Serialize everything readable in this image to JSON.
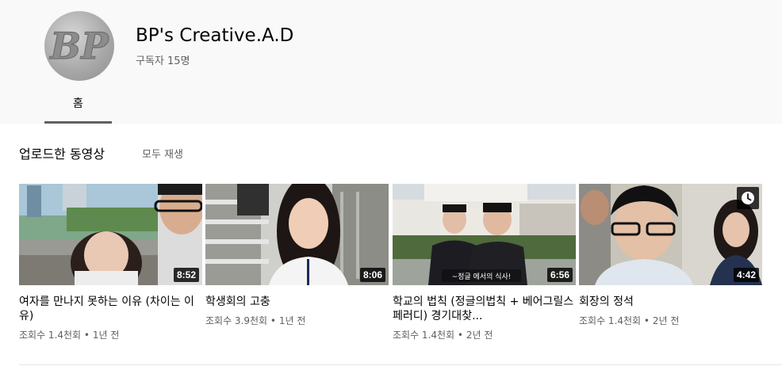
{
  "channel": {
    "name": "BP's Creative.A.D",
    "subscribers": "구독자 15명",
    "avatar_text": "BP"
  },
  "tabs": [
    {
      "label": "홈",
      "selected": true
    }
  ],
  "shelf": {
    "title": "업로드한 동영상",
    "play_all": "모두 재생"
  },
  "videos": [
    {
      "title": "여자를 만나지 못하는 이유 (차이는 이유)",
      "duration": "8:52",
      "views": "조회수 1.4천회",
      "age": "1년 전"
    },
    {
      "title": "학생회의 고충",
      "duration": "8:06",
      "views": "조회수 3.9천회",
      "age": "1년 전"
    },
    {
      "title": "학교의 법칙 (정글의법칙 + 베어그릴스 페러디) 경기대찾...",
      "duration": "6:56",
      "views": "조회수 1.4천회",
      "age": "2년 전",
      "caption": "~정글 에서의 식사!"
    },
    {
      "title": "회장의 정석",
      "duration": "4:42",
      "views": "조회수 1.4천회",
      "age": "2년 전"
    }
  ],
  "meta_separator": " • ",
  "colors": {
    "header_bg": "#f9f9f9",
    "secondary_text": "#606060",
    "tab_indicator": "#606060"
  }
}
